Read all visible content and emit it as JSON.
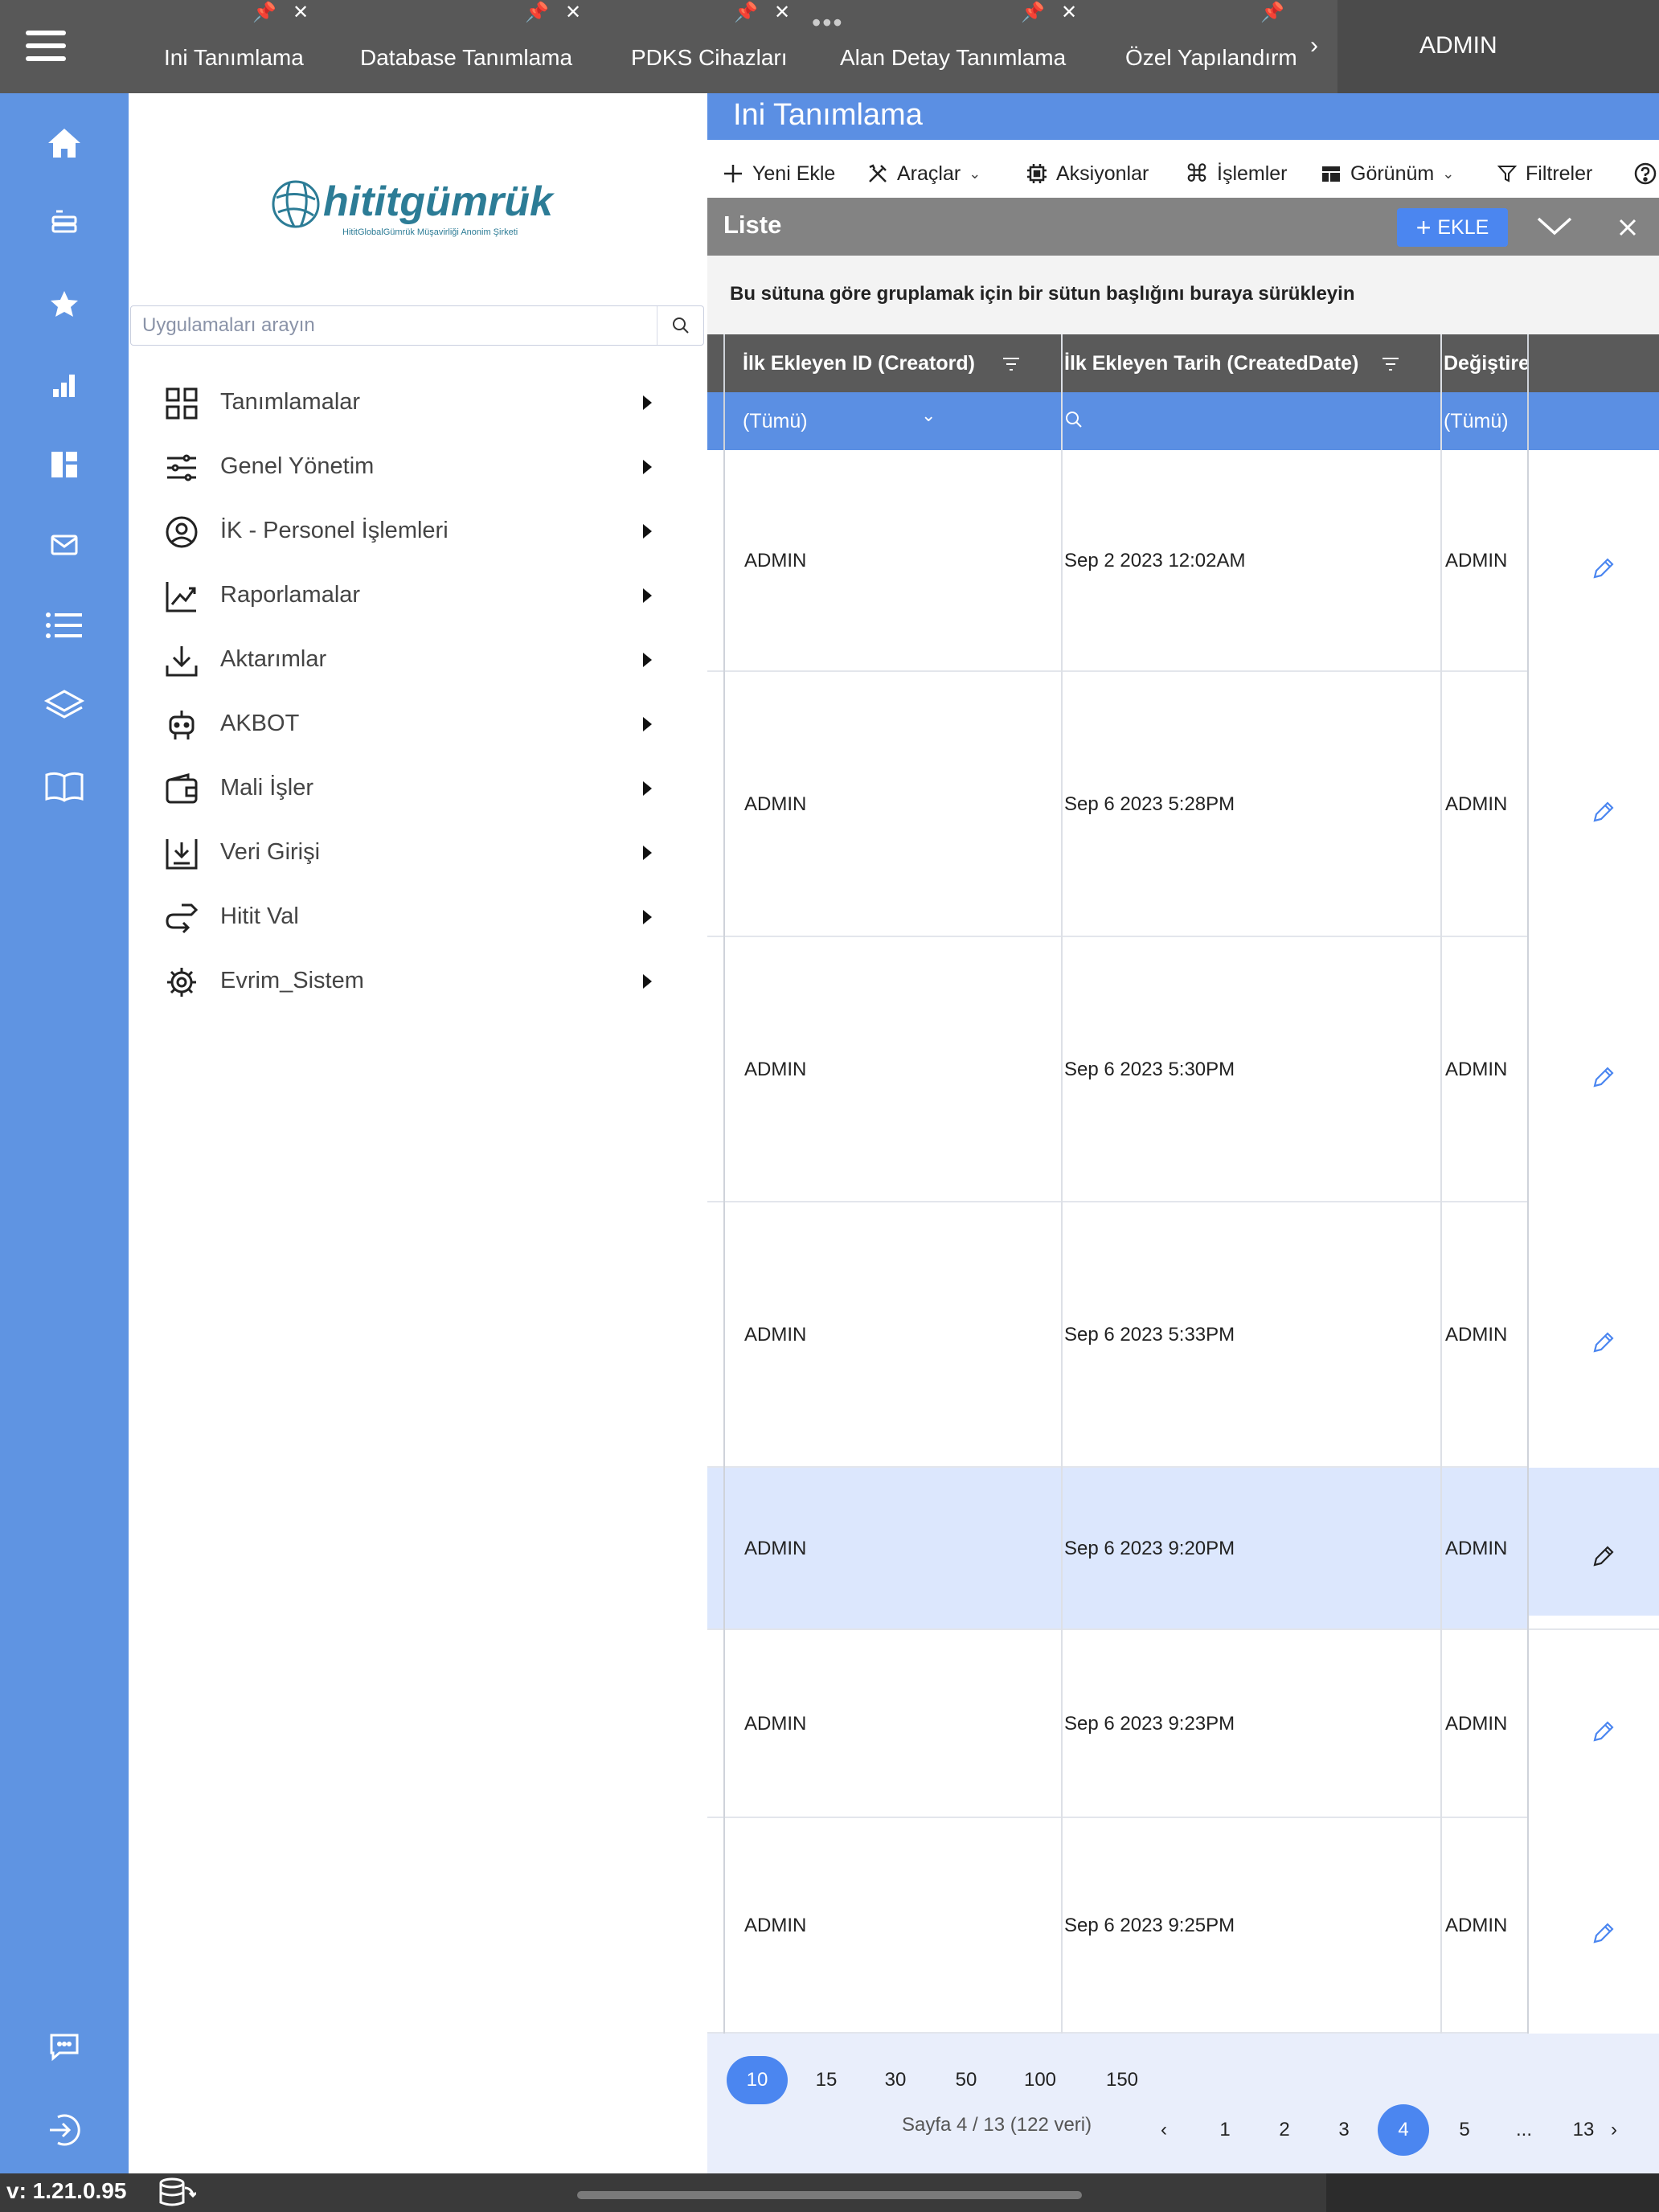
{
  "topbar": {
    "tabs": [
      {
        "label": "Ini Tanımlama"
      },
      {
        "label": "Database Tanımlama"
      },
      {
        "label": "PDKS Cihazları"
      },
      {
        "label": "Alan Detay Tanımlama"
      },
      {
        "label": "Özel Yapılandırm"
      }
    ],
    "user": "ADMIN"
  },
  "iconbar": {
    "icons": [
      "home-icon",
      "server-icon",
      "star-icon",
      "bar-chart-icon",
      "dashboard-icon",
      "mail-icon",
      "list-icon",
      "layers-icon",
      "book-icon"
    ],
    "bottom_icons": [
      "chat-icon",
      "logout-icon"
    ]
  },
  "sidebar": {
    "logo_text": "hititgümrük",
    "logo_subtitle": "HititGlobalGümrük Müşavirliği Anonim Şirketi",
    "search_placeholder": "Uygulamaları arayın",
    "items": [
      {
        "label": "Tanımlamalar",
        "icon": "grid-icon"
      },
      {
        "label": "Genel Yönetim",
        "icon": "sliders-icon"
      },
      {
        "label": "İK - Personel İşlemleri",
        "icon": "user-circle-icon"
      },
      {
        "label": "Raporlamalar",
        "icon": "trend-chart-icon"
      },
      {
        "label": "Aktarımlar",
        "icon": "download-icon"
      },
      {
        "label": "AKBOT",
        "icon": "robot-icon"
      },
      {
        "label": "Mali İşler",
        "icon": "wallet-icon"
      },
      {
        "label": "Veri Girişi",
        "icon": "data-entry-icon"
      },
      {
        "label": "Hitit Val",
        "icon": "route-icon"
      },
      {
        "label": "Evrim_Sistem",
        "icon": "cog-icon"
      }
    ]
  },
  "main": {
    "title": "Ini Tanımlama",
    "toolbar": {
      "new": "Yeni Ekle",
      "tools": "Araçlar",
      "actions": "Aksiyonlar",
      "operations": "İşlemler",
      "view": "Görünüm",
      "filters": "Filtreler"
    },
    "panel_title": "Liste",
    "add_button": "EKLE",
    "group_hint": "Bu sütuna göre gruplamak için bir sütun başlığını buraya sürükleyin",
    "columns": [
      "İlk Ekleyen ID (Creatord)",
      "İlk Ekleyen Tarih (CreatedDate)",
      "Değiştire"
    ],
    "filters": [
      "(Tümü)",
      "",
      "(Tümü)"
    ],
    "rows": [
      {
        "creator": "ADMIN",
        "date": "Sep 2 2023 12:02AM",
        "modifier": "ADMIN"
      },
      {
        "creator": "ADMIN",
        "date": "Sep 6 2023 5:28PM",
        "modifier": "ADMIN"
      },
      {
        "creator": "ADMIN",
        "date": "Sep 6 2023 5:30PM",
        "modifier": "ADMIN"
      },
      {
        "creator": "ADMIN",
        "date": "Sep 6 2023 5:33PM",
        "modifier": "ADMIN"
      },
      {
        "creator": "ADMIN",
        "date": "Sep 6 2023 9:20PM",
        "modifier": "ADMIN"
      },
      {
        "creator": "ADMIN",
        "date": "Sep 6 2023 9:23PM",
        "modifier": "ADMIN"
      },
      {
        "creator": "ADMIN",
        "date": "Sep 6 2023 9:25PM",
        "modifier": "ADMIN"
      }
    ],
    "selected_row": 4,
    "pager": {
      "sizes": [
        "10",
        "15",
        "30",
        "50",
        "100",
        "150"
      ],
      "active_size": "10",
      "info": "Sayfa 4 / 13 (122 veri)",
      "pages": [
        "1",
        "2",
        "3",
        "4",
        "5",
        "...",
        "13"
      ],
      "active_page": "4"
    }
  },
  "footer": {
    "version": "v: 1.21.0.95"
  },
  "colors": {
    "accent": "#4b86f0",
    "sidebar": "#5f94e2",
    "topbar": "#585858",
    "selected_row": "#dce7fd"
  }
}
